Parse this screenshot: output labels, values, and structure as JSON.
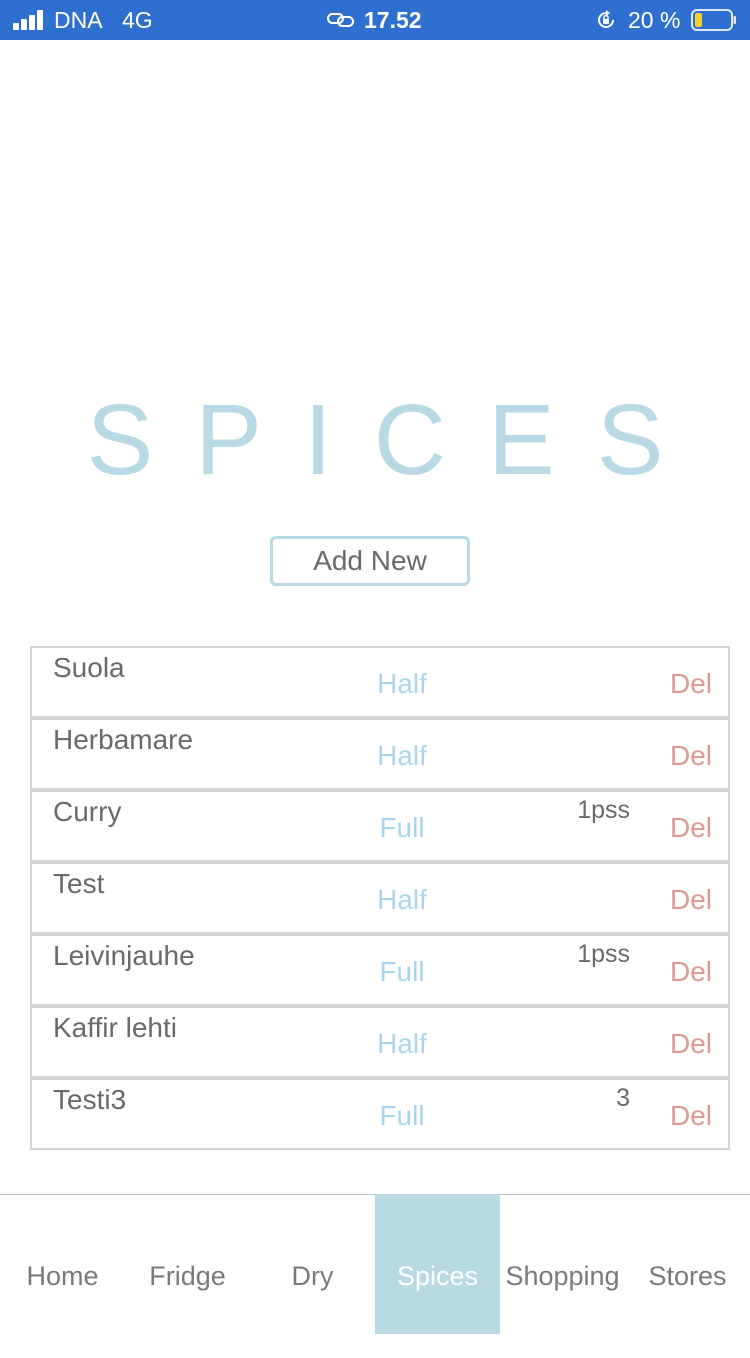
{
  "status_bar": {
    "carrier": "DNA",
    "network": "4G",
    "time": "17.52",
    "battery_percent": "20 %",
    "icons": [
      "signal-icon",
      "link-icon",
      "orientation-lock-icon",
      "battery-icon"
    ],
    "background_color": "#2f6fd0",
    "battery_level": 0.2
  },
  "title": "SPICES",
  "add_new_label": "Add New",
  "spices": [
    {
      "name": "Suola",
      "level": "Half",
      "note": "",
      "delete_label": "Del"
    },
    {
      "name": "Herbamare",
      "level": "Half",
      "note": "",
      "delete_label": "Del"
    },
    {
      "name": "Curry",
      "level": "Full",
      "note": "1pss",
      "delete_label": "Del"
    },
    {
      "name": "Test",
      "level": "Half",
      "note": "",
      "delete_label": "Del"
    },
    {
      "name": "Leivinjauhe",
      "level": "Full",
      "note": "1pss",
      "delete_label": "Del"
    },
    {
      "name": "Kaffir lehti",
      "level": "Half",
      "note": "",
      "delete_label": "Del"
    },
    {
      "name": "Testi3",
      "level": "Full",
      "note": "3",
      "delete_label": "Del"
    }
  ],
  "nav": {
    "items": [
      {
        "label": "Home"
      },
      {
        "label": "Fridge"
      },
      {
        "label": "Dry"
      },
      {
        "label": "Spices"
      },
      {
        "label": "Shopping"
      },
      {
        "label": "Stores"
      }
    ],
    "active": "Spices"
  },
  "colors": {
    "accent": "#b7dae4",
    "level_text": "#a9d6ec",
    "delete_text": "#dc9a93",
    "body_text": "#6a6a6a"
  }
}
